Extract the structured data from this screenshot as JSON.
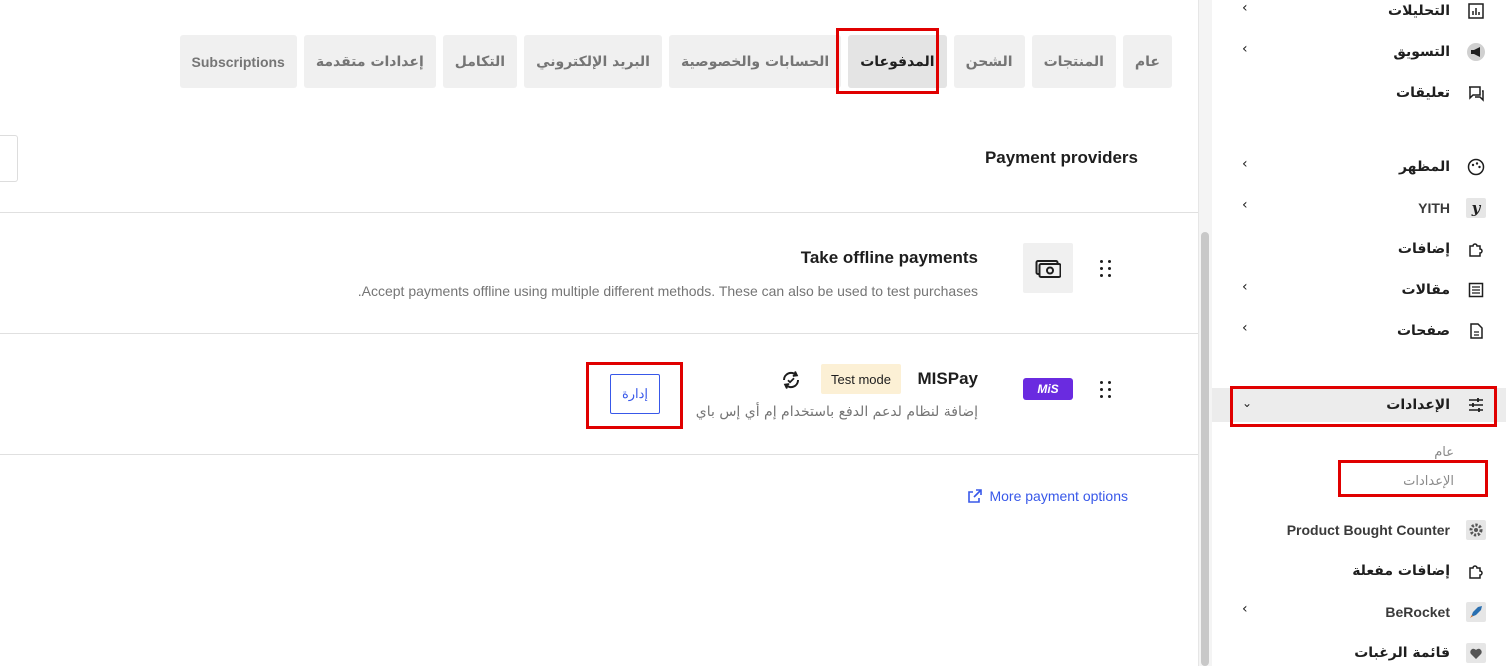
{
  "tabs": [
    {
      "label": "عام",
      "active": false
    },
    {
      "label": "المنتجات",
      "active": false
    },
    {
      "label": "الشحن",
      "active": false
    },
    {
      "label": "المدفوعات",
      "active": true
    },
    {
      "label": "الحسابات والخصوصية",
      "active": false
    },
    {
      "label": "البريد الإلكتروني",
      "active": false
    },
    {
      "label": "التكامل",
      "active": false
    },
    {
      "label": "إعدادات متقدمة",
      "active": false
    },
    {
      "label": "Subscriptions",
      "active": false
    }
  ],
  "main": {
    "section_title": "Payment providers",
    "offline": {
      "title": "Take offline payments",
      "description": ".Accept payments offline using multiple different methods. These can also be used to test purchases",
      "icon": "cash-icon"
    },
    "mispay": {
      "title": "MISPay",
      "logo_text": "MiS",
      "badge": "Test mode",
      "description": "إضافة لنظام لدعم الدفع باستخدام إم أي إس باي",
      "manage_label": "إدارة",
      "icon": "sync-icon"
    },
    "more_link": "More payment options"
  },
  "sidebar": {
    "items": [
      {
        "label": "التحليلات",
        "icon": "chart-icon",
        "chevron": true
      },
      {
        "label": "التسويق",
        "icon": "megaphone-icon",
        "chevron": true
      },
      {
        "label": "تعليقات",
        "icon": "comment-icon",
        "chevron": false
      },
      {
        "label": "المظهر",
        "icon": "palette-icon",
        "chevron": true
      },
      {
        "label": "YITH",
        "icon": "yith-icon",
        "chevron": true
      },
      {
        "label": "إضافات",
        "icon": "plugin-icon",
        "chevron": false
      },
      {
        "label": "مقالات",
        "icon": "posts-icon",
        "chevron": true
      },
      {
        "label": "صفحات",
        "icon": "page-icon",
        "chevron": true
      },
      {
        "label": "الإعدادات",
        "icon": "settings-sliders-icon",
        "chevron": true,
        "active": true
      },
      {
        "label": "Product Bought Counter",
        "icon": "gear-icon",
        "chevron": false
      },
      {
        "label": "إضافات مفعلة",
        "icon": "plugin-icon",
        "chevron": false
      },
      {
        "label": "BeRocket",
        "icon": "rocket-icon",
        "chevron": true
      },
      {
        "label": "قائمة الرغبات",
        "icon": "heart-icon",
        "chevron": false
      }
    ],
    "sub_items": [
      {
        "label": "عام"
      },
      {
        "label": "الإعدادات"
      }
    ]
  },
  "colors": {
    "accent": "#3858e9",
    "highlight": "#e00000",
    "badge_bg": "#fcf0d5",
    "mispay_brand": "#6a2be0"
  }
}
